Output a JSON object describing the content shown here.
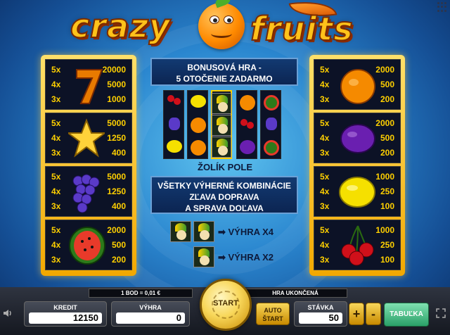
{
  "logo": {
    "word_left": "crazy",
    "word_right": "fruits"
  },
  "paytable_left": [
    {
      "symbol": "seven-icon",
      "rows": [
        {
          "mult": "5x",
          "amount": "20000"
        },
        {
          "mult": "4x",
          "amount": "5000"
        },
        {
          "mult": "3x",
          "amount": "1000"
        }
      ]
    },
    {
      "symbol": "star-icon",
      "rows": [
        {
          "mult": "5x",
          "amount": "5000"
        },
        {
          "mult": "4x",
          "amount": "1250"
        },
        {
          "mult": "3x",
          "amount": "400"
        }
      ]
    },
    {
      "symbol": "grapes-icon",
      "rows": [
        {
          "mult": "5x",
          "amount": "5000"
        },
        {
          "mult": "4x",
          "amount": "1250"
        },
        {
          "mult": "3x",
          "amount": "400"
        }
      ]
    },
    {
      "symbol": "watermelon-icon",
      "rows": [
        {
          "mult": "5x",
          "amount": "2000"
        },
        {
          "mult": "4x",
          "amount": "500"
        },
        {
          "mult": "3x",
          "amount": "200"
        }
      ]
    }
  ],
  "paytable_right": [
    {
      "symbol": "orange-icon",
      "rows": [
        {
          "mult": "5x",
          "amount": "2000"
        },
        {
          "mult": "4x",
          "amount": "500"
        },
        {
          "mult": "3x",
          "amount": "200"
        }
      ]
    },
    {
      "symbol": "plum-icon",
      "rows": [
        {
          "mult": "5x",
          "amount": "2000"
        },
        {
          "mult": "4x",
          "amount": "500"
        },
        {
          "mult": "3x",
          "amount": "200"
        }
      ]
    },
    {
      "symbol": "lemon-icon",
      "rows": [
        {
          "mult": "5x",
          "amount": "1000"
        },
        {
          "mult": "4x",
          "amount": "250"
        },
        {
          "mult": "3x",
          "amount": "100"
        }
      ]
    },
    {
      "symbol": "cherries-icon",
      "rows": [
        {
          "mult": "5x",
          "amount": "1000"
        },
        {
          "mult": "4x",
          "amount": "250"
        },
        {
          "mult": "3x",
          "amount": "100"
        }
      ]
    }
  ],
  "bonus": {
    "line1": "BONUSOVÁ HRA -",
    "line2": "5 OTOČENIE ZADARMO"
  },
  "pole_label": "ŽOLÍK POLE",
  "combos": {
    "line1": "VŠETKY VÝHERNÉ KOMBINÁCIE",
    "line2": "ZĽAVA DOPRAVA",
    "line3": "A SPRAVA DOĽAVA"
  },
  "win_x4": "➡ VÝHRA X4",
  "win_x2": "➡ VÝHRA X2",
  "colors": {
    "gold": "#ffd000",
    "panel_dark": "#0c1226",
    "accent_green": "#2aa068"
  },
  "bottom": {
    "bod_info": "1 BOD = 0,01 €",
    "game_status": "HRA UKONČENÁ",
    "kredit_label": "KREDIT",
    "kredit_value": "12150",
    "vyhra_label": "VÝHRA",
    "vyhra_value": "0",
    "start_label": "START",
    "auto_line1": "AUTO",
    "auto_line2": "ŠTART",
    "stavka_label": "STÁVKA",
    "stavka_value": "50",
    "plus_label": "+",
    "minus_label": "-",
    "tabulka_label": "TABUĽKA"
  }
}
